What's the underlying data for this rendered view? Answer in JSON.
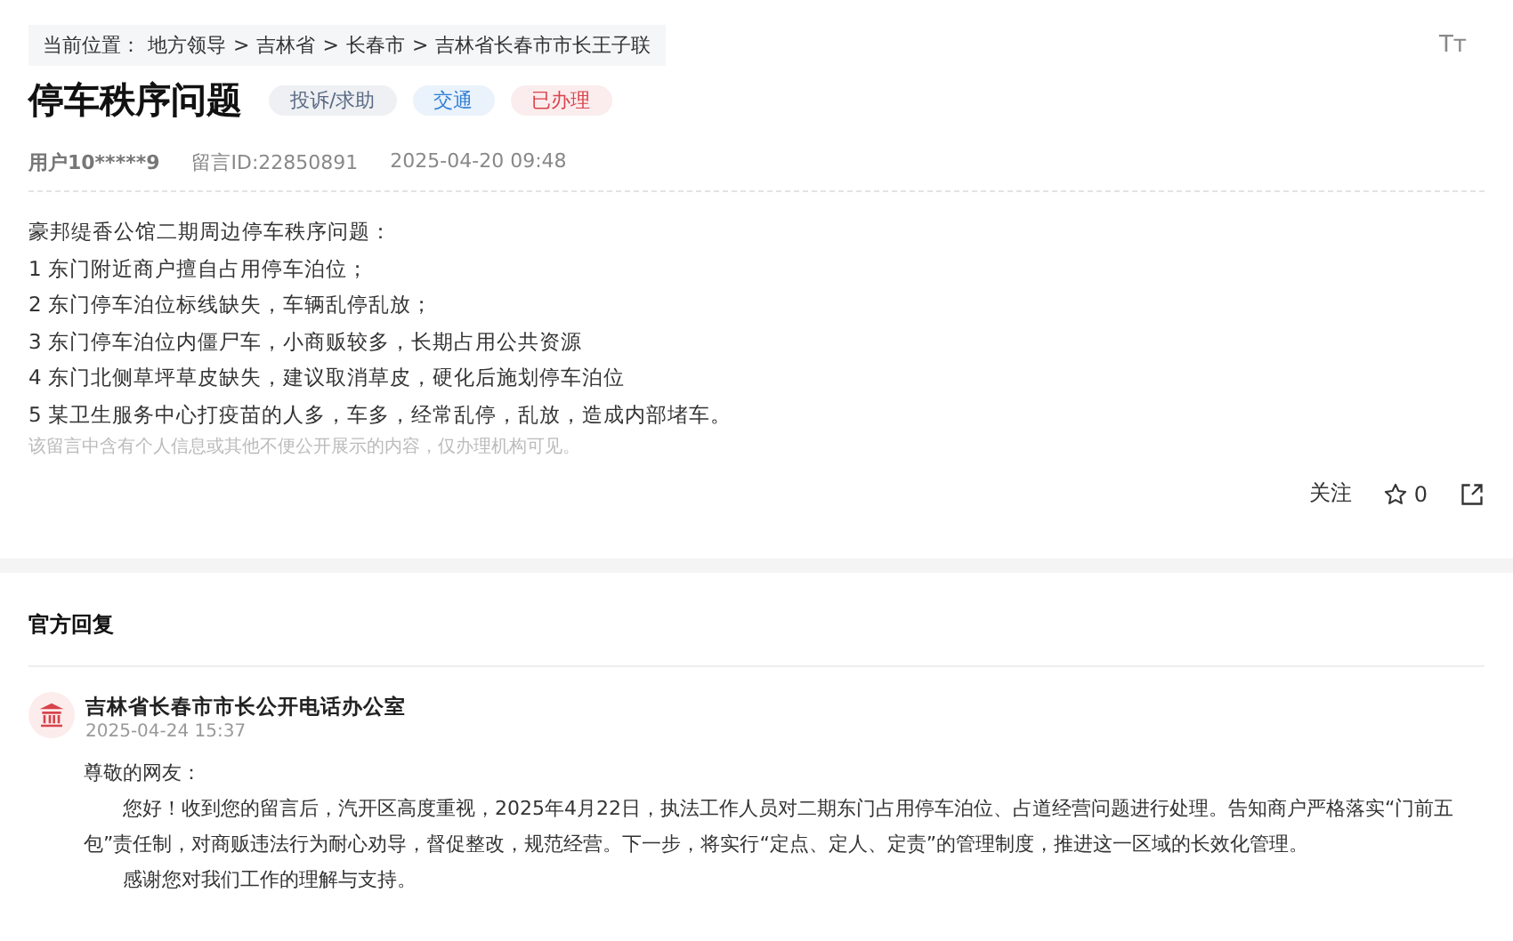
{
  "breadcrumb": {
    "label": "当前位置：",
    "items": [
      "地方领导",
      "吉林省",
      "长春市",
      "吉林省长春市市长王子联"
    ],
    "separator": ">"
  },
  "font_size_button": {
    "label": "Tт"
  },
  "title": "停车秩序问题",
  "tags": [
    {
      "label": "投诉/求助",
      "color": "#5a6a85"
    },
    {
      "label": "交通",
      "color": "#2f7fd4"
    },
    {
      "label": "已办理",
      "color": "#d9434b"
    }
  ],
  "meta": {
    "user": "用户10*****9",
    "message_id": "留言ID:22850891",
    "time": "2025-04-20 09:48"
  },
  "content": [
    "豪邦缇香公馆二期周边停车秩序问题：",
    "1 东门附近商户擅自占用停车泊位；",
    "2 东门停车泊位标线缺失，车辆乱停乱放；",
    "3 东门停车泊位内僵尸车，小商贩较多，长期占用公共资源",
    "4 东门北侧草坪草皮缺失，建议取消草皮，硬化后施划停车泊位",
    "5 某卫生服务中心打疫苗的人多，车多，经常乱停，乱放，造成内部堵车。"
  ],
  "privacy_note": "该留言中含有个人信息或其他不便公开展示的内容，仅办理机构可见。",
  "actions": {
    "follow": "关注",
    "favorite_count": "0"
  },
  "reply": {
    "heading": "官方回复",
    "office": "吉林省长春市市长公开电话办公室",
    "time": "2025-04-24 15:37",
    "greeting": "尊敬的网友：",
    "paragraphs": [
      "您好！收到您的留言后，汽开区高度重视，2025年4月22日，执法工作人员对二期东门占用停车泊位、占道经营问题进行处理。告知商户严格落实“门前五包”责任制，对商贩违法行为耐心劝导，督促整改，规范经营。下一步，将实行“定点、定人、定责”的管理制度，推进这一区域的长效化管理。",
      "感谢您对我们工作的理解与支持。"
    ]
  }
}
